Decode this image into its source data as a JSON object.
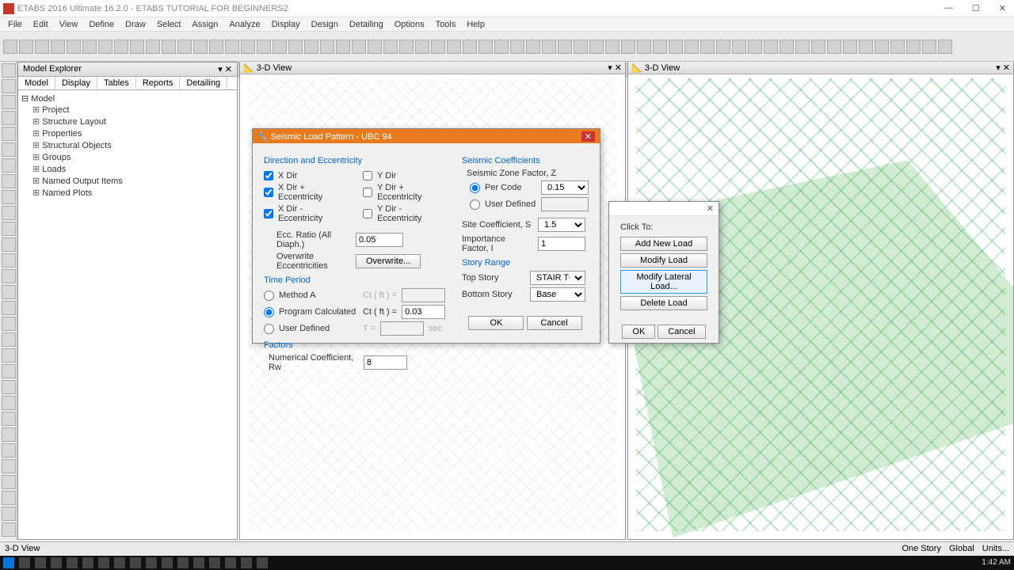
{
  "window": {
    "title": "ETABS 2016 Ultimate 16.2.0 - ETABS TUTORIAL FOR BEGINNERS2"
  },
  "menu": [
    "File",
    "Edit",
    "View",
    "Define",
    "Draw",
    "Select",
    "Assign",
    "Analyze",
    "Display",
    "Design",
    "Detailing",
    "Options",
    "Tools",
    "Help"
  ],
  "explorer": {
    "title": "Model Explorer",
    "tabs": [
      "Model",
      "Display",
      "Tables",
      "Reports",
      "Detailing"
    ],
    "root": "Model",
    "items": [
      "Project",
      "Structure Layout",
      "Properties",
      "Structural Objects",
      "Groups",
      "Loads",
      "Named Output Items",
      "Named Plots"
    ]
  },
  "views": {
    "left": "3-D View",
    "right": "3-D View"
  },
  "seismic": {
    "title": "Seismic Load Pattern - UBC 94",
    "dir_section": "Direction and Eccentricity",
    "x_dir": "X Dir",
    "y_dir": "Y Dir",
    "x_ecc_p": "X Dir + Eccentricity",
    "y_ecc_p": "Y Dir + Eccentricity",
    "x_ecc_m": "X Dir - Eccentricity",
    "y_ecc_m": "Y Dir - Eccentricity",
    "ecc_ratio_label": "Ecc. Ratio (All Diaph.)",
    "ecc_ratio": "0.05",
    "overwrite_label": "Overwrite Eccentricities",
    "overwrite_btn": "Overwrite...",
    "time_section": "Time Period",
    "methodA": "Method A",
    "ct1": "Ct ( ft ) =",
    "program_calc": "Program Calculated",
    "ct2": "Ct ( ft ) =",
    "ct_val": "0.03",
    "user_def": "User Defined",
    "T": "T =",
    "sec": "sec",
    "factors_section": "Factors",
    "rw_label": "Numerical Coefficient, Rw",
    "rw": "8",
    "coef_section": "Seismic Coefficients",
    "zone_label": "Seismic Zone Factor, Z",
    "per_code": "Per Code",
    "z_val": "0.15",
    "user_def2": "User Defined",
    "site_label": "Site Coefficient, S",
    "site_val": "1.5",
    "imp_label": "Importance Factor, I",
    "imp_val": "1",
    "story_section": "Story Range",
    "top_story": "Top Story",
    "top_val": "STAIR TOP",
    "bot_story": "Bottom Story",
    "bot_val": "Base",
    "ok": "OK",
    "cancel": "Cancel"
  },
  "loads_dialog": {
    "click_to": "Click To:",
    "add": "Add New Load",
    "modify": "Modify Load",
    "modify_lateral": "Modify Lateral Load...",
    "delete": "Delete Load",
    "ok": "OK",
    "cancel": "Cancel"
  },
  "status": {
    "left": "3-D View",
    "story": "One Story",
    "global": "Global",
    "units": "Units..."
  },
  "taskbar": {
    "time": "1:42 AM"
  }
}
